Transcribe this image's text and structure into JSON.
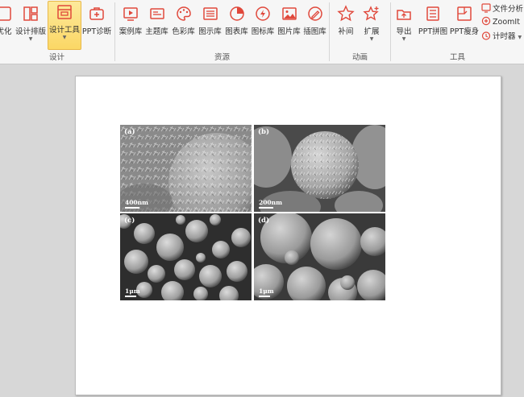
{
  "ribbon": {
    "design_group": {
      "label": "设计",
      "buttons": [
        {
          "label": "优化",
          "icon": "optimize-icon"
        },
        {
          "label": "设计排版",
          "icon": "layout-icon"
        },
        {
          "label": "设计工具",
          "icon": "design-tool-icon",
          "active": true
        },
        {
          "label": "PPT诊断",
          "icon": "diagnose-icon"
        }
      ]
    },
    "resource_group": {
      "label": "资源",
      "buttons": [
        {
          "label": "案例库",
          "icon": "case-library-icon"
        },
        {
          "label": "主题库",
          "icon": "theme-library-icon"
        },
        {
          "label": "色彩库",
          "icon": "palette-icon"
        },
        {
          "label": "图示库",
          "icon": "diagram-library-icon"
        },
        {
          "label": "图表库",
          "icon": "chart-library-icon"
        },
        {
          "label": "图标库",
          "icon": "icon-library-icon"
        },
        {
          "label": "图片库",
          "icon": "picture-library-icon"
        },
        {
          "label": "插图库",
          "icon": "illustration-library-icon"
        }
      ]
    },
    "animation_group": {
      "label": "动画",
      "buttons": [
        {
          "label": "补间",
          "icon": "star-icon"
        },
        {
          "label": "扩展",
          "icon": "star-plus-icon"
        }
      ]
    },
    "tools_group": {
      "label": "工具",
      "buttons": [
        {
          "label": "导出",
          "icon": "export-icon"
        },
        {
          "label": "PPT拼图",
          "icon": "collage-icon"
        },
        {
          "label": "PPT瘦身",
          "icon": "slim-icon"
        }
      ],
      "small_buttons": [
        {
          "label": "文件分析",
          "icon": "file-analysis-icon"
        },
        {
          "label": "ZoomIt",
          "icon": "zoom-icon"
        },
        {
          "label": "计时器",
          "icon": "timer-icon"
        }
      ]
    }
  },
  "slide": {
    "panels": [
      {
        "label": "(a)",
        "scale": "400nm"
      },
      {
        "label": "(b)",
        "scale": "200nm"
      },
      {
        "label": "(c)",
        "scale": "1μm"
      },
      {
        "label": "(d)",
        "scale": "1μm"
      }
    ]
  },
  "colors": {
    "accent": "#e0483b",
    "active_bg": "#fbd765",
    "ribbon_bg": "#f6f6f6",
    "workspace_bg": "#d7d7d7"
  }
}
